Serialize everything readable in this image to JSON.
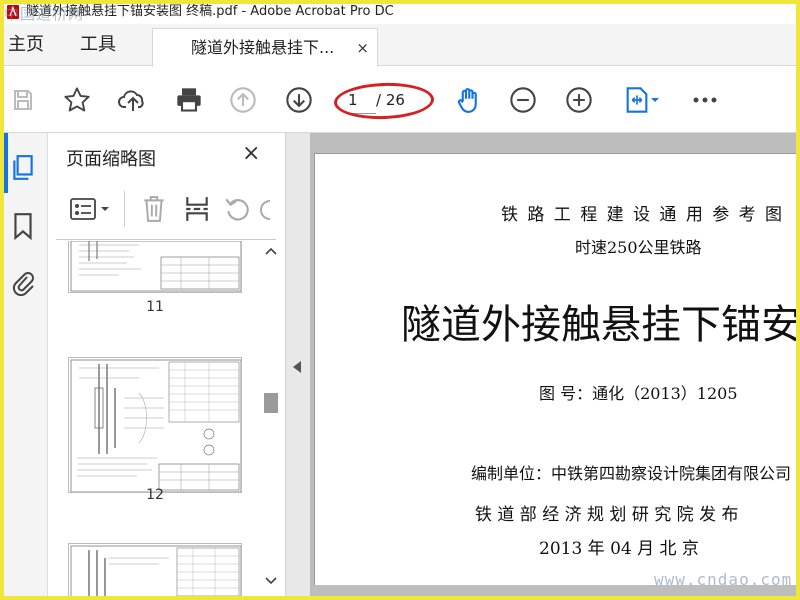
{
  "window": {
    "title": "隧道外接触悬挂下锚安装图 终稿.pdf - Adobe Acrobat Pro DC",
    "watermark_top": "中国道桥网"
  },
  "tabs": {
    "home": "主页",
    "tools": "工具",
    "document": "隧道外接触悬挂下...",
    "close": "×"
  },
  "toolbar": {
    "page_current": "1",
    "page_total": "/ 26",
    "icons": [
      "save-icon",
      "bookmark-star-icon",
      "upload-icon",
      "print-icon",
      "page-up-icon",
      "page-down-icon",
      "hand-tool-icon",
      "zoom-out-icon",
      "zoom-in-icon",
      "fit-page-icon",
      "more-icon"
    ],
    "accent": "#1473e6",
    "highlight": "#d42020"
  },
  "panel": {
    "title": "页面缩略图",
    "close": "×",
    "thumbnails": [
      {
        "label": "11"
      },
      {
        "label": "12"
      },
      {
        "label": ""
      }
    ]
  },
  "document": {
    "line1": "铁 路 工 程 建 设 通 用 参 考 图",
    "line2": "时速250公里铁路",
    "title": "隧道外接触悬挂下锚安装",
    "drawing_no": "图  号：通化（2013）1205",
    "compiler": "编制单位：中铁第四勘察设计院集团有限公司",
    "publisher": "铁 道 部 经 济 规 划 研 究 院    发 布",
    "date": "2013 年 04 月    北 京",
    "watermark": "www.cndao.com"
  }
}
